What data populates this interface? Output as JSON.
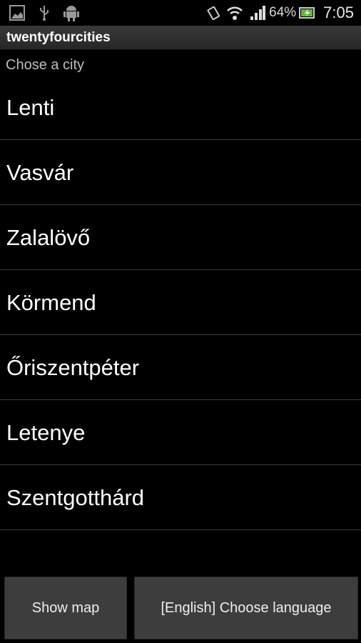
{
  "status_bar": {
    "left_icons": [
      "gallery-icon",
      "usb-icon",
      "android-icon"
    ],
    "right_icons": [
      "vibrate-icon",
      "wifi-icon",
      "signal-icon",
      "battery-charging-icon"
    ],
    "battery_percent": "64%",
    "time": "7:05"
  },
  "app": {
    "title": "twentyfourcities",
    "subtitle": "Chose a city"
  },
  "cities": [
    {
      "label": "Lenti"
    },
    {
      "label": "Vasvár"
    },
    {
      "label": "Zalalövő"
    },
    {
      "label": "Körmend"
    },
    {
      "label": "Őriszentpéter"
    },
    {
      "label": "Letenye"
    },
    {
      "label": "Szentgotthárd"
    }
  ],
  "buttons": {
    "show_map": "Show map",
    "choose_language": "[English] Choose language"
  }
}
